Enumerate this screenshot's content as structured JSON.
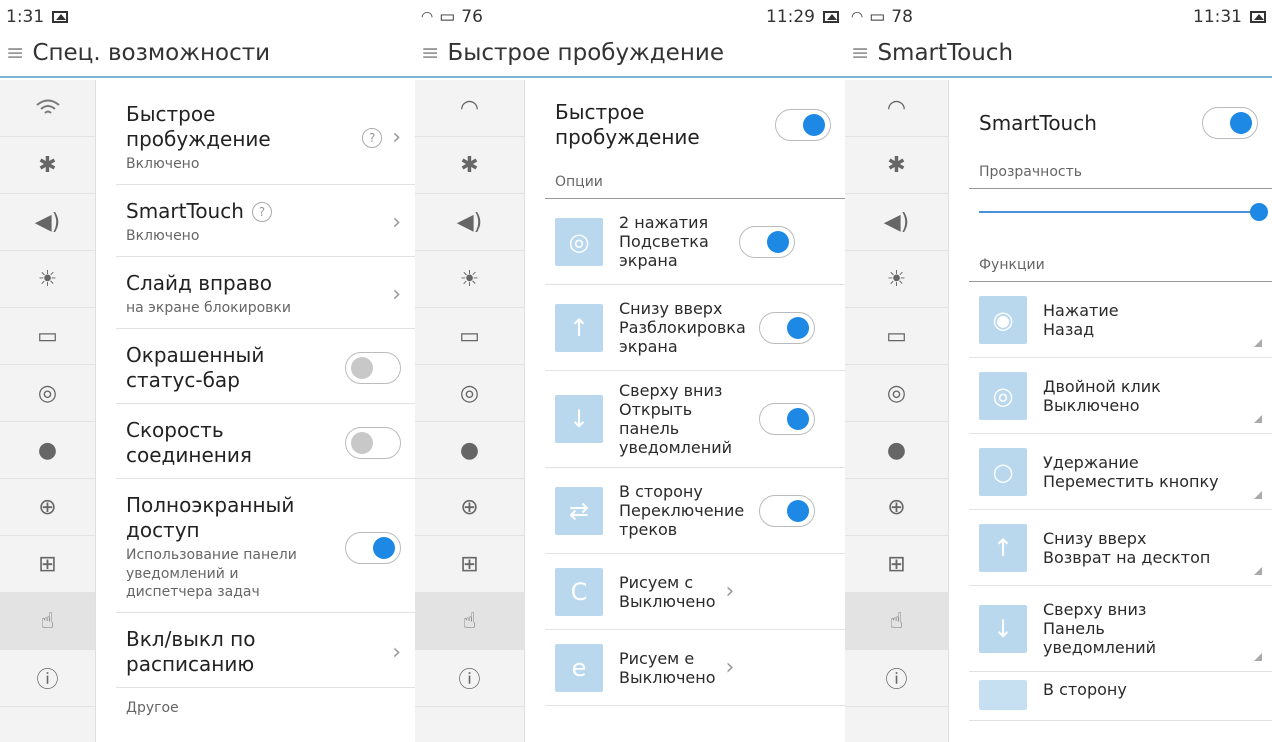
{
  "panel1": {
    "status_time": "1:31",
    "title": "Спец. возможности",
    "rows": [
      {
        "title": "Быстрое пробуждение",
        "sub": "Включено",
        "help": "?"
      },
      {
        "title": "SmartTouch",
        "sub": "Включено",
        "help": "?"
      },
      {
        "title": "Слайд вправо",
        "sub": "на экране блокировки"
      },
      {
        "title": "Окрашенный статус-бар"
      },
      {
        "title": "Скорость соединения"
      },
      {
        "title": "Полноэкранный доступ",
        "sub": "Использование панели уведомлений и диспетчера задач"
      },
      {
        "title": "Вкл/выкл по расписанию"
      }
    ],
    "section_other": "Другое"
  },
  "panel2": {
    "status_left": "76",
    "status_time": "11:29",
    "title": "Быстрое пробуждение",
    "top_row": "Быстрое пробуждение",
    "section": "Опции",
    "rows": [
      {
        "title": "2 нажатия",
        "sub": "Подсветка экрана"
      },
      {
        "title": "Снизу вверх",
        "sub": "Разблокировка экрана"
      },
      {
        "title": "Сверху вниз",
        "sub": "Открыть панель уведомлений"
      },
      {
        "title": "В сторону",
        "sub": "Переключение треков"
      },
      {
        "title": "Рисуем с",
        "sub": "Выключено"
      },
      {
        "title": "Рисуем е",
        "sub": "Выключено"
      }
    ]
  },
  "panel3": {
    "status_left": "78",
    "status_time": "11:31",
    "title": "SmartTouch",
    "top_row": "SmartTouch",
    "section_transparency": "Прозрачность",
    "section_functions": "Функции",
    "rows": [
      {
        "title": "Нажатие",
        "sub": "Назад"
      },
      {
        "title": "Двойной клик",
        "sub": "Выключено"
      },
      {
        "title": "Удержание",
        "sub": "Переместить кнопку"
      },
      {
        "title": "Снизу вверх",
        "sub": "Возврат на десктоп"
      },
      {
        "title": "Сверху вниз",
        "sub": "Панель уведомлений"
      },
      {
        "title": "В сторону"
      }
    ]
  },
  "colors": {
    "accent": "#1e88e5",
    "title_rule": "#7fb3d5",
    "gesture_icon": "#b9d8ee"
  }
}
